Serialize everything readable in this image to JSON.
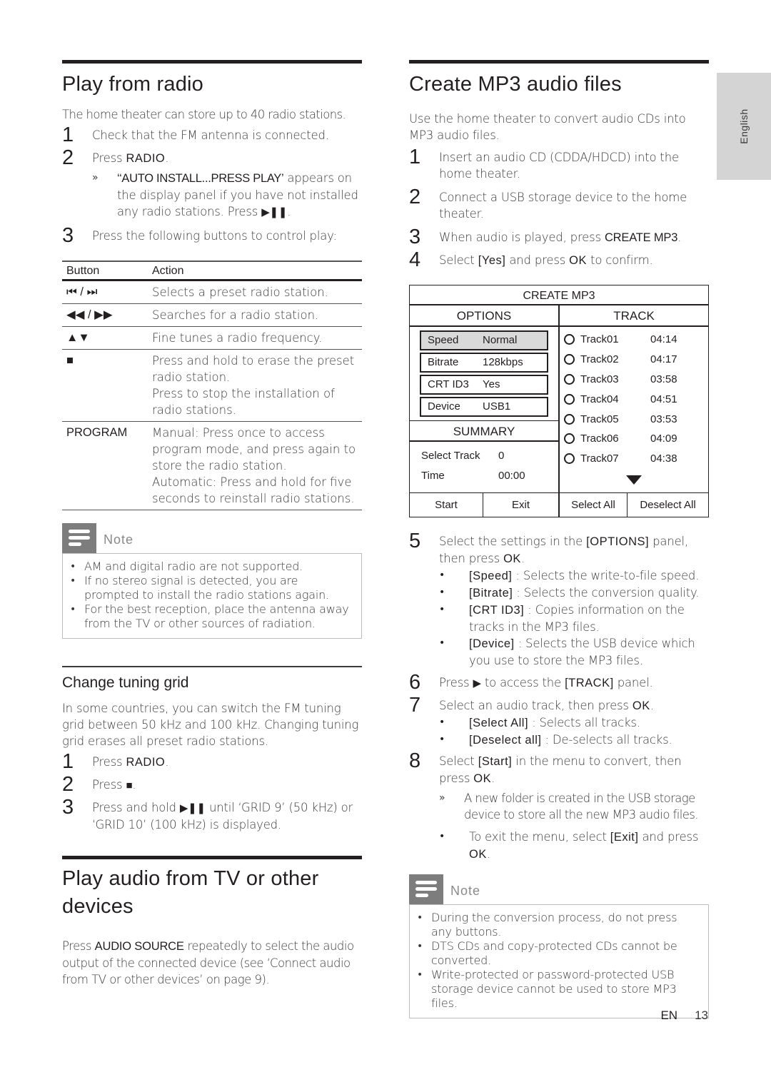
{
  "language_tab": "English",
  "footer": {
    "lang": "EN",
    "page": "13"
  },
  "left": {
    "radio": {
      "title": "Play from radio",
      "intro": "The home theater can store up to 40 radio stations.",
      "steps": [
        {
          "num": "1",
          "text": "Check that the FM antenna is connected."
        },
        {
          "num": "2",
          "pre": "Press ",
          "kw": "RADIO",
          "post": "."
        },
        {
          "num": "3",
          "text": "Press the following buttons to control play:"
        }
      ],
      "sub_mark": "»",
      "sub": {
        "kw": "‘‘AUTO INSTALL...PRESS PLAY’",
        "text": " appears on the display panel if you have not installed any radio stations. Press ",
        "glyph": "▶❚❚",
        "post": "."
      },
      "table": {
        "headers": [
          "Button",
          "Action"
        ],
        "rows": [
          {
            "button": "⏮ / ⏭",
            "icon": "previous-next-icon",
            "action": [
              "Selects a preset radio station."
            ]
          },
          {
            "button": "◀◀ / ▶▶",
            "icon": "rewind-forward-icon",
            "action": [
              "Searches for a radio station."
            ]
          },
          {
            "button": "▲▼",
            "icon": "up-down-icon",
            "action": [
              "Fine tunes a radio frequency."
            ]
          },
          {
            "button": "■",
            "icon": "stop-icon",
            "action": [
              "Press and hold to erase the preset radio station.",
              "Press to stop the installation of radio stations."
            ]
          },
          {
            "button": "PROGRAM",
            "icon": "",
            "action": [
              "Manual: Press once to access program mode, and press again to store the radio station.",
              "Automatic: Press and hold for five seconds to reinstall radio stations."
            ]
          }
        ]
      },
      "note": {
        "title": "Note",
        "items": [
          "AM and digital radio are not supported.",
          "If no stereo signal is detected, you are prompted to install the radio stations again.",
          "For the best reception, place the antenna away from the TV or other sources of radiation."
        ]
      }
    },
    "tuning": {
      "title": "Change tuning grid",
      "intro": "In some countries, you can switch the FM tuning grid between 50 kHz and 100 kHz. Changing tuning grid erases all preset radio stations.",
      "steps": [
        {
          "num": "1",
          "pre": "Press ",
          "kw": "RADIO",
          "post": "."
        },
        {
          "num": "2",
          "pre": "Press ",
          "glyph": "■",
          "post": "."
        },
        {
          "num": "3",
          "pre": "Press and hold ",
          "glyph": "▶❚❚",
          "post": " until ‘GRID 9’ (50 kHz) or ‘GRID 10’ (100 kHz) is displayed."
        }
      ]
    },
    "tv": {
      "title": "Play audio from TV or other devices",
      "pre": "Press ",
      "kw": "AUDIO SOURCE",
      "post": " repeatedly to select the audio output of the connected device (see ‘Connect audio from TV or other devices’ on page 9)."
    }
  },
  "right": {
    "mp3": {
      "title": "Create MP3 audio files",
      "intro": "Use the home theater to convert audio CDs into MP3 audio files.",
      "steps_a": [
        {
          "num": "1",
          "text": "Insert an audio CD (CDDA/HDCD) into the home theater."
        },
        {
          "num": "2",
          "text": "Connect a USB storage device to the home theater."
        },
        {
          "num": "3",
          "pre": "When audio is played, press ",
          "kw": "CREATE MP3",
          "post": "."
        },
        {
          "num": "4",
          "pre": "Select ",
          "kw": "[Yes]",
          "mid": " and press ",
          "kw2": "OK",
          "post": " to confirm."
        }
      ],
      "screen": {
        "title": "CREATE MP3",
        "options_label": "OPTIONS",
        "track_label": "TRACK",
        "options": [
          {
            "key": "Speed",
            "value": "Normal",
            "selected": true
          },
          {
            "key": "Bitrate",
            "value": "128kbps",
            "selected": false
          },
          {
            "key": "CRT ID3",
            "value": "Yes",
            "selected": false
          },
          {
            "key": "Device",
            "value": "USB1",
            "selected": false
          }
        ],
        "summary_label": "SUMMARY",
        "summary": [
          {
            "key": "Select Track",
            "value": "0"
          },
          {
            "key": "Time",
            "value": "00:00"
          }
        ],
        "tracks": [
          {
            "name": "Track01",
            "time": "04:14"
          },
          {
            "name": "Track02",
            "time": "04:17"
          },
          {
            "name": "Track03",
            "time": "03:58"
          },
          {
            "name": "Track04",
            "time": "04:51"
          },
          {
            "name": "Track05",
            "time": "03:53"
          },
          {
            "name": "Track06",
            "time": "04:09"
          },
          {
            "name": "Track07",
            "time": "04:38"
          }
        ],
        "buttons": [
          "Start",
          "Exit",
          "Select All",
          "Deselect All"
        ]
      },
      "step5": {
        "num": "5",
        "pre": "Select the settings in the ",
        "kw": "[OPTIONS]",
        "mid": " panel, then press ",
        "kw2": "OK",
        "post": "."
      },
      "step5_bullets": [
        {
          "kw": "[Speed]",
          "text": " : Selects the write-to-file speed."
        },
        {
          "kw": "[Bitrate]",
          "text": " : Selects the conversion quality."
        },
        {
          "kw": "[CRT ID3]",
          "text": " : Copies information on the tracks in the MP3 files."
        },
        {
          "kw": "[Device]",
          "text": " : Selects the USB device which you use to store the MP3 files."
        }
      ],
      "step6": {
        "num": "6",
        "pre": "Press ",
        "glyph": "▶",
        "mid": " to access the ",
        "kw": "[TRACK]",
        "post": " panel."
      },
      "step7": {
        "num": "7",
        "pre": "Select an audio track, then press ",
        "kw": "OK",
        "post": "."
      },
      "step7_bullets": [
        {
          "kw": "[Select All]",
          "text": " : Selects all tracks."
        },
        {
          "kw": "[Deselect all]",
          "text": " : De-selects all tracks."
        }
      ],
      "step8": {
        "num": "8",
        "pre": "Select ",
        "kw": "[Start]",
        "mid": " in the menu to convert, then press ",
        "kw2": "OK",
        "post": "."
      },
      "step8_sub": "A new folder is created in the USB storage device to store all the new MP3 audio files.",
      "step8_bullet": {
        "pre": "To exit the menu, select ",
        "kw": "[Exit]",
        "mid": " and press ",
        "kw2": "OK",
        "post": "."
      },
      "bullet_mark": "•",
      "note": {
        "title": "Note",
        "items": [
          "During the conversion process, do not press any buttons.",
          "DTS CDs and copy-protected CDs cannot be converted.",
          "Write-protected or password-protected USB storage device cannot be used to store MP3 files."
        ]
      }
    }
  }
}
